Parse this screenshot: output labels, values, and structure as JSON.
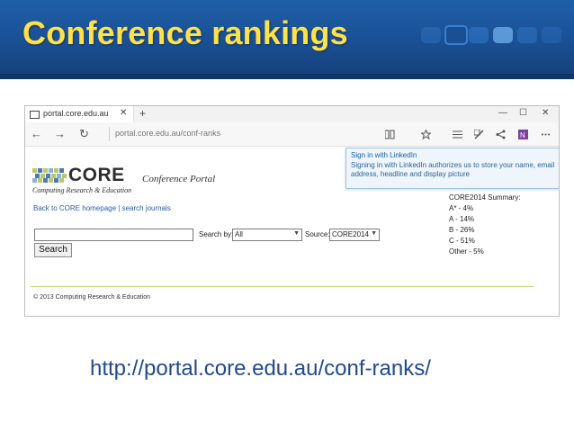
{
  "slide": {
    "title": "Conference rankings",
    "url_caption": "http://portal.core.edu.au/conf-ranks/"
  },
  "browser": {
    "tab_title": "portal.core.edu.au",
    "address": "portal.core.edu.au/conf-ranks",
    "window_controls": [
      "—",
      "☐",
      "✕"
    ],
    "new_tab": "+",
    "tab_close": "✕"
  },
  "signin": {
    "title": "Sign in with LinkedIn",
    "body": "Signing in with LinkedIn authorizes us to store your name, email address, headline and display picture"
  },
  "portal": {
    "logo_text": "CORE",
    "tagline": "Computing Research & Education",
    "title": "Conference Portal",
    "link_home": "Back to CORE homepage",
    "link_sep": " | ",
    "link_journals": "search journals",
    "search_button": "Search",
    "search_by_label": "Search by:",
    "search_by_value": "All",
    "source_label": "Source:",
    "source_value": "CORE2014",
    "copyright": "© 2013 Computing Research & Education"
  },
  "summary": {
    "heading": "CORE2014 Summary:",
    "items": [
      "A* - 4%",
      "A - 14%",
      "B - 26%",
      "C - 51%",
      "Other - 5%"
    ]
  },
  "colors": {
    "header_bg": "#1a4f93",
    "title_color": "#ffe14a",
    "link_color": "#2a5ca8",
    "accent_green": "#c9d96a"
  }
}
